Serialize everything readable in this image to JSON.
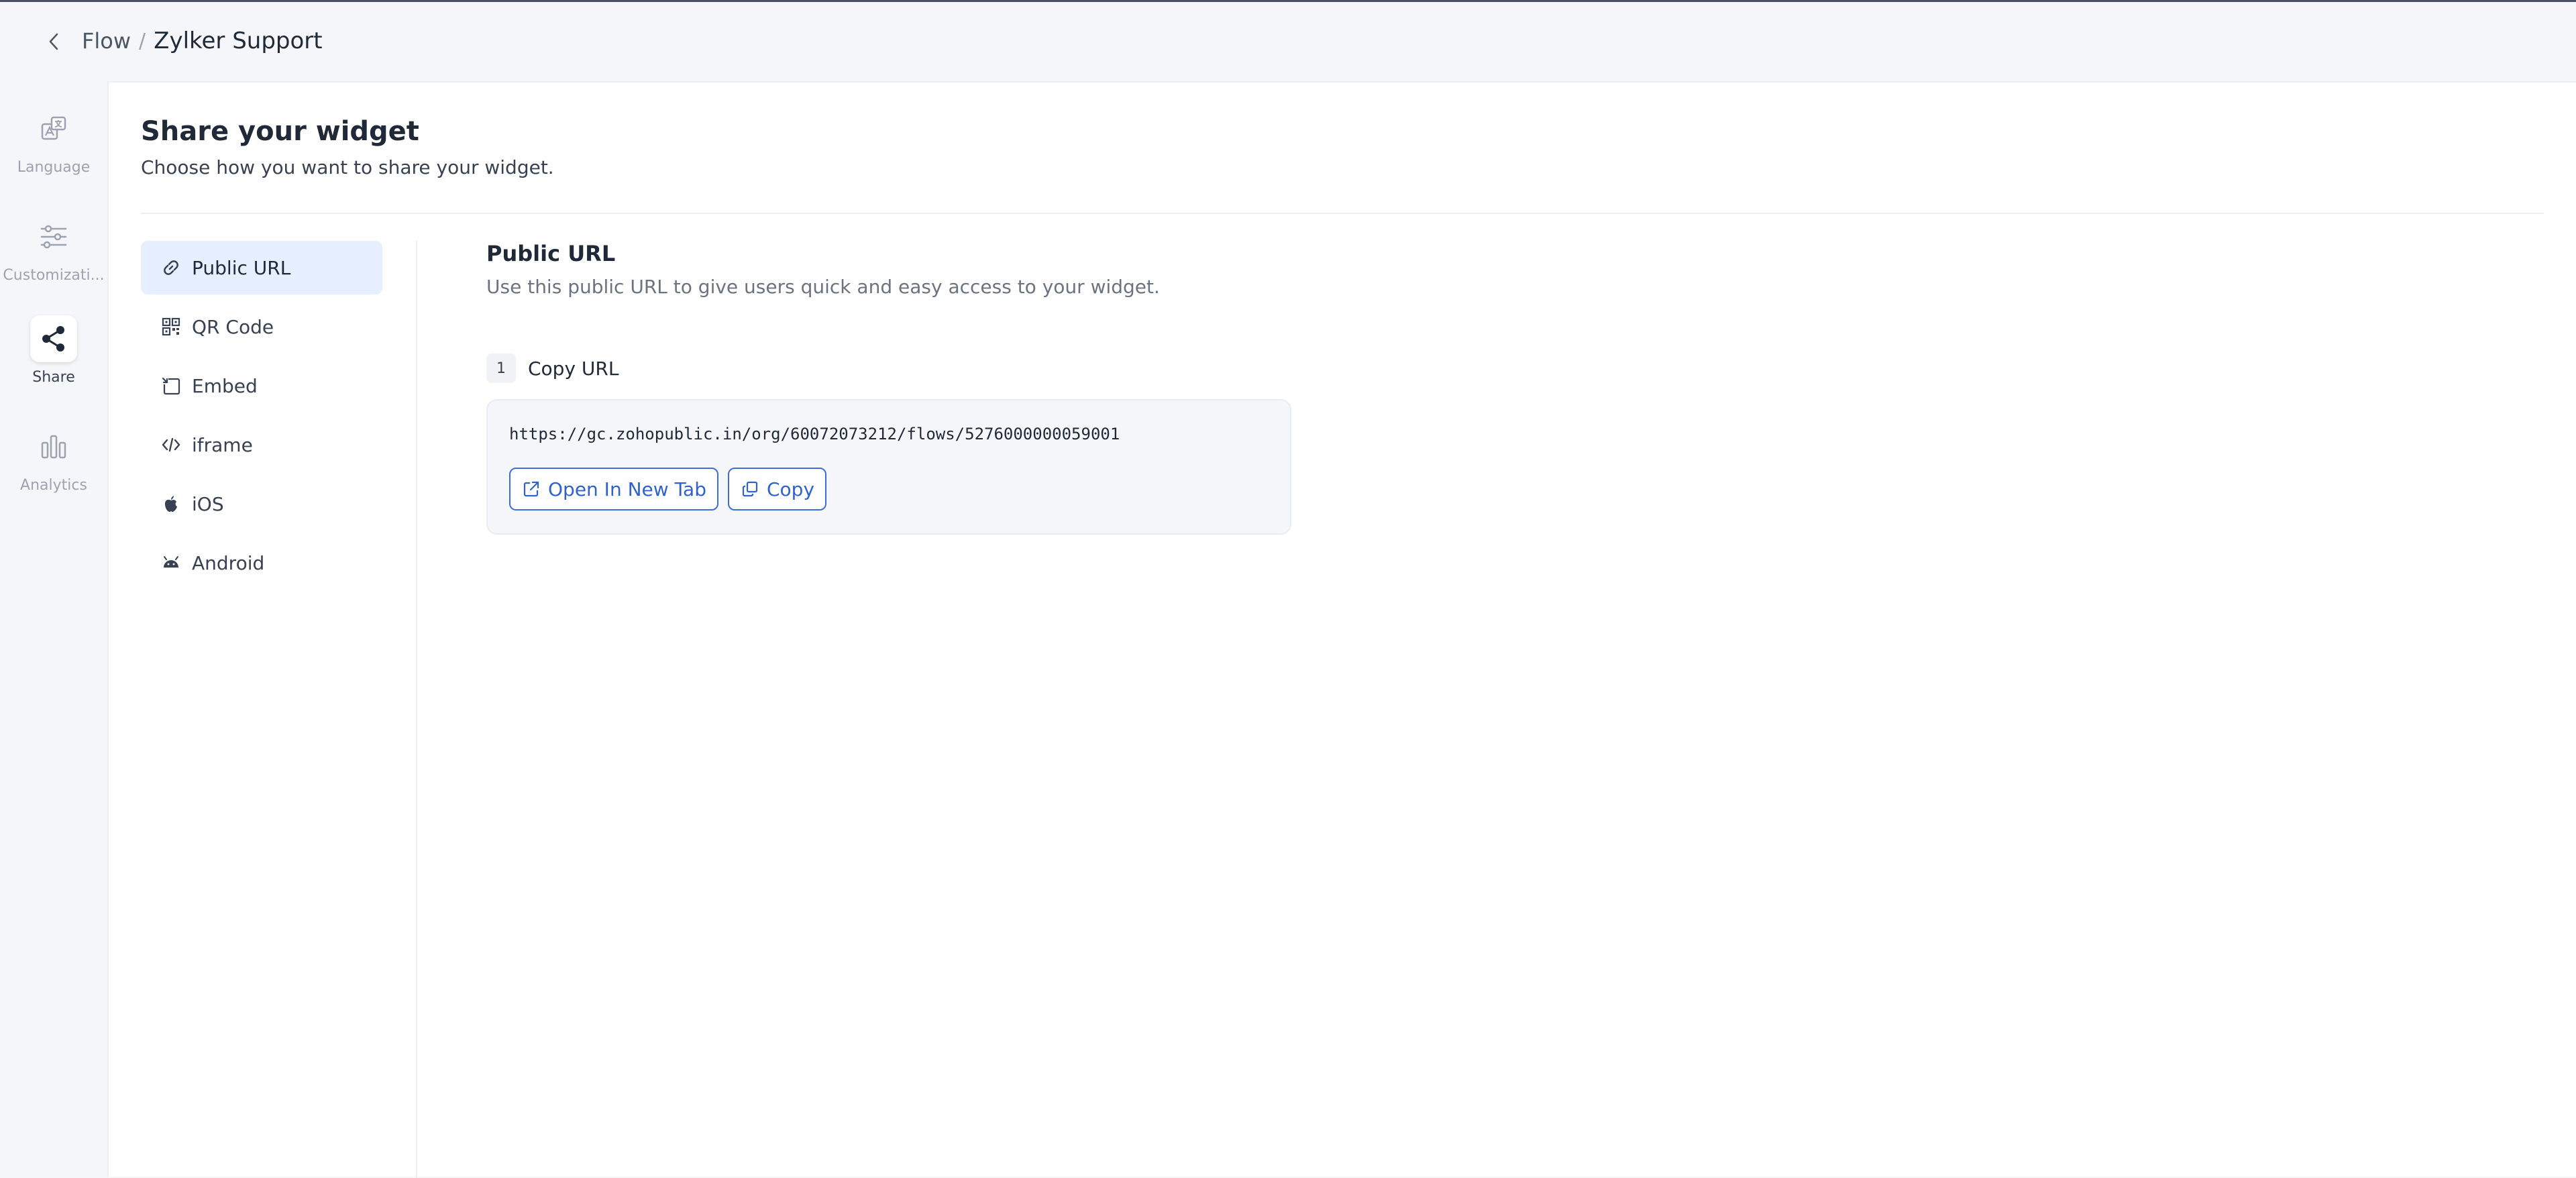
{
  "header": {
    "breadcrumb_parent": "Flow",
    "separator": "/",
    "title": "Zylker Support"
  },
  "rail": {
    "items": [
      {
        "label": "Language",
        "icon": "language-icon",
        "active": false
      },
      {
        "label": "Customizati...",
        "icon": "sliders-icon",
        "active": false
      },
      {
        "label": "Share",
        "icon": "share-icon",
        "active": true
      },
      {
        "label": "Analytics",
        "icon": "bar-chart-icon",
        "active": false
      }
    ]
  },
  "page": {
    "title": "Share your widget",
    "subtitle": "Choose how you want to share your widget."
  },
  "subnav": {
    "items": [
      {
        "label": "Public URL",
        "icon": "link-icon",
        "active": true
      },
      {
        "label": "QR Code",
        "icon": "qr-code-icon",
        "active": false
      },
      {
        "label": "Embed",
        "icon": "embed-icon",
        "active": false
      },
      {
        "label": "iframe",
        "icon": "code-icon",
        "active": false
      },
      {
        "label": "iOS",
        "icon": "apple-icon",
        "active": false
      },
      {
        "label": "Android",
        "icon": "android-icon",
        "active": false
      }
    ]
  },
  "content": {
    "title": "Public URL",
    "description": "Use this public URL to give users quick and easy access to your widget.",
    "step_number": "1",
    "step_label": "Copy URL",
    "url": "https://gc.zohopublic.in/org/60072073212/flows/5276000000059001",
    "open_button": "Open In New Tab",
    "copy_button": "Copy"
  },
  "colors": {
    "accent": "#2f62cf",
    "active_bg": "#e6efff",
    "app_bg": "#f5f6fa"
  }
}
